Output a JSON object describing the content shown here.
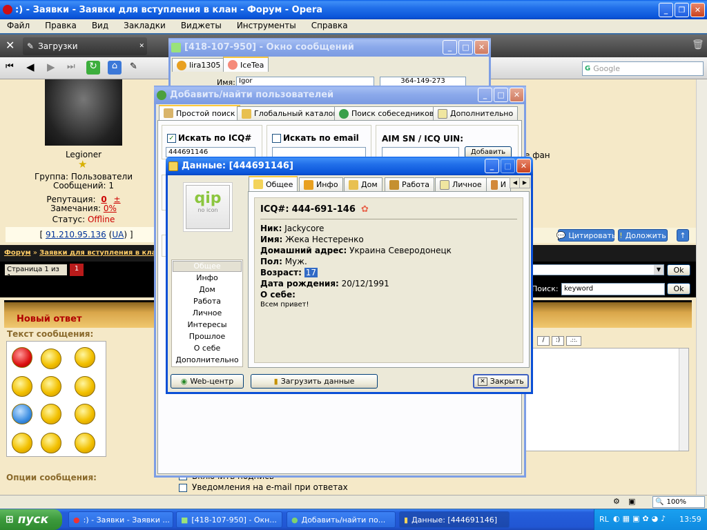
{
  "opera": {
    "title": ":) - Заявки - Заявки для вступления в клан - Форум - Opera",
    "menu": [
      "Файл",
      "Правка",
      "Вид",
      "Закладки",
      "Виджеты",
      "Инструменты",
      "Справка"
    ],
    "tab_downloads": "Загрузки",
    "search_placeholder": "Google"
  },
  "forum": {
    "username": "Legioner",
    "group": "Группа: Пользователи",
    "messages": "Сообщений: 1",
    "reputation_label": "Репутация:",
    "reputation_value": "0",
    "reputation_plus": "±",
    "warnings_label": "Замечания:",
    "warnings_value": "0%",
    "status_label": "Статус:",
    "status_value": "Offline",
    "ip_open": "[",
    "ip": "91.210.95.136",
    "ip_country": "UA",
    "ip_close": "]",
    "quote_btn": "Цитировать",
    "report_btn": "Доложить",
    "breadcrumb_forum": "Форум",
    "breadcrumb_sep": "»",
    "breadcrumb_section": "Заявки для вступления в клан",
    "breadcrumb_more": "»",
    "page_info": "Страница 1 из 1",
    "page_current": "1",
    "ok": "Ok",
    "search_label": "Поиск:",
    "search_value": "keyword",
    "new_reply": "Новый ответ",
    "message_text": "Текст сообщения:",
    "options": "Опции сообщения:",
    "opt_signature": "Включить подпись",
    "opt_email": "Уведомления на e-mail при ответах",
    "fan_text": "е фан",
    "fmt_buttons": [
      "/",
      ":)",
      ".::."
    ],
    "zoom": "100%"
  },
  "msgwin": {
    "title": "[418-107-950] - Окно сообщений",
    "tab1": "lira1305",
    "tab2": "IceTea",
    "name_label": "Имя:",
    "name_value": "Igor",
    "uin": "364-149-273"
  },
  "addwin": {
    "title": "Добавить/найти пользователей",
    "tabs": [
      "Простой поиск",
      "Глобальный каталог",
      "Поиск собеседников",
      "Дополнительно"
    ],
    "by_icq": "Искать по ICQ#",
    "by_email": "Искать по email",
    "aim": "AIM SN / ICQ UIN:",
    "icq_value": "444691146",
    "add_btn": "Добавить"
  },
  "datawin": {
    "title": "Данные: [444691146]",
    "logo_top": "qip",
    "logo_bottom": "no icon",
    "tabs": [
      "Общее",
      "Инфо",
      "Дом",
      "Работа",
      "Личное",
      "И"
    ],
    "side": [
      "Общее",
      "Инфо",
      "Дом",
      "Работа",
      "Личное",
      "Интересы",
      "Прошлое",
      "О себе",
      "Дополнительно"
    ],
    "icq_label": "ICQ#:",
    "icq_value": "444-691-146",
    "nick_label": "Ник:",
    "nick_value": "Jackycore",
    "name_label": "Имя:",
    "name_value": "Жека Нестеренко",
    "address_label": "Домашний адрес:",
    "address_value": "Украина Северодонецк",
    "gender_label": "Пол:",
    "gender_value": "Муж.",
    "age_label": "Возраст:",
    "age_value": "17",
    "birth_label": "Дата рождения:",
    "birth_value": "20/12/1991",
    "about_label": "О себе:",
    "about_value": "Всем привет!",
    "btn_web": "Web-центр",
    "btn_load": "Загрузить данные",
    "btn_close": "Закрыть"
  },
  "taskbar": {
    "start": "пуск",
    "tasks": [
      ":) - Заявки - Заявки ...",
      "[418-107-950] - Окн...",
      "Добавить/найти по...",
      "Данные: [444691146]"
    ],
    "lang": "RL",
    "time": "13:59"
  },
  "colors": {
    "xp_blue": "#0a5ee8",
    "start_green": "#3c9a3c",
    "forum_red": "#cc0000"
  }
}
